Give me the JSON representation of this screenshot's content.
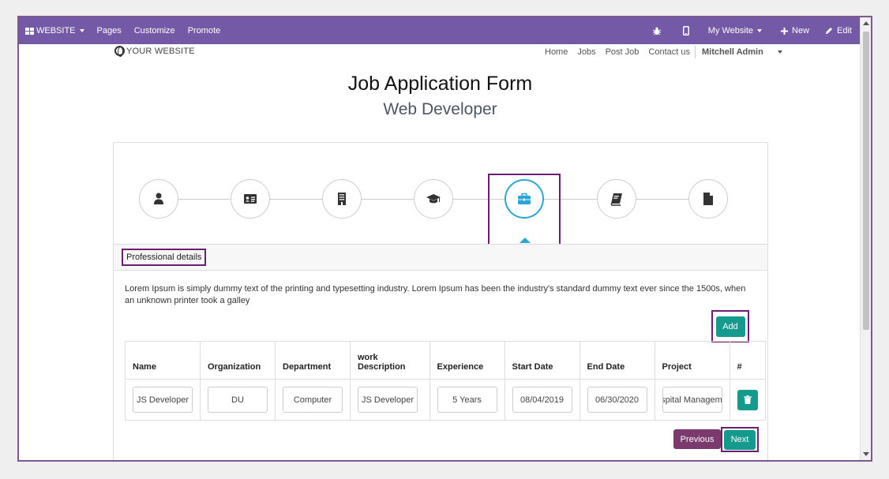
{
  "topbar": {
    "website_label": "WEBSITE",
    "pages": "Pages",
    "customize": "Customize",
    "promote": "Promote",
    "my_website": "My Website",
    "new_label": "New",
    "edit_label": "Edit",
    "color": "#7459a6"
  },
  "header": {
    "logo_text": "YOUR WEBSITE",
    "nav": [
      "Home",
      "Jobs",
      "Post Job",
      "Contact us"
    ],
    "user": "Mitchell Admin"
  },
  "page": {
    "title": "Job Application Form",
    "subtitle": "Web Developer"
  },
  "steps": {
    "icons": [
      "user-icon",
      "id-card-icon",
      "building-icon",
      "graduation-cap-icon",
      "briefcase-icon",
      "book-icon",
      "file-icon"
    ],
    "active_index": 4,
    "active_color": "#29a6d6"
  },
  "section": {
    "label": "Professional details",
    "description": "Lorem Ipsum is simply dummy text of the printing and typesetting industry. Lorem Ipsum has been the industry's standard dummy text ever since the 1500s, when an unknown printer took a galley"
  },
  "buttons": {
    "add": "Add",
    "previous": "Previous",
    "next": "Next",
    "teal": "#159a8e"
  },
  "table": {
    "headers": [
      "Name",
      "Organization",
      "Department",
      "work Description",
      "Experience",
      "Start Date",
      "End Date",
      "Project",
      "#"
    ],
    "row": [
      "JS Developer",
      "DU",
      "Computer",
      "JS Developer",
      "5 Years",
      "08/04/2019",
      "06/30/2020",
      "Hospital Management"
    ]
  }
}
